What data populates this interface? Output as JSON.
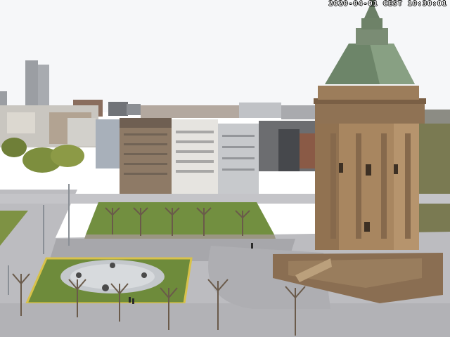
{
  "webcam": {
    "timestamp": "2020-04-01 CEST 10:30:01"
  },
  "colors": {
    "sky": "#f4f6f8",
    "tower_stone": "#9a7a55",
    "tower_roof": "#6f8a6a",
    "lawn": "#6e8c3e",
    "plaza": "#a9a9ad",
    "road": "#b8b8bc"
  }
}
